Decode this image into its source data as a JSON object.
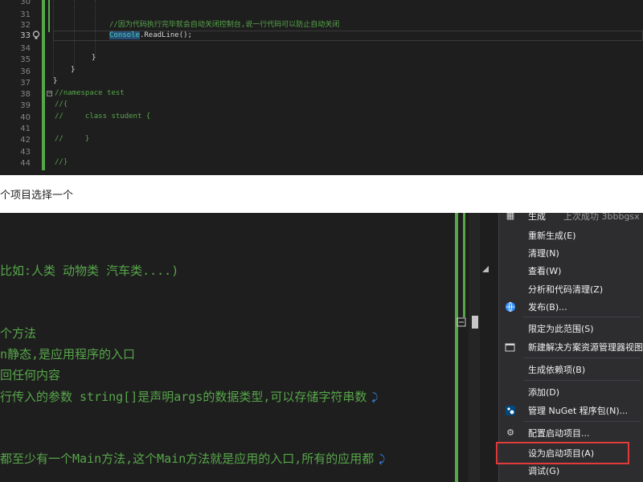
{
  "top_editor": {
    "line_numbers": [
      "30",
      "31",
      "32",
      "33",
      "34",
      "35",
      "36",
      "37",
      "38",
      "39",
      "40",
      "41",
      "42",
      "43",
      "44"
    ],
    "active_line": "33",
    "lines": {
      "l32_comment": "//因为代码执行完毕就会自动关闭控制台,说一行代码可以防止自动关闭",
      "l33_class": "Console",
      "l33_rest": ".ReadLine();",
      "l35_brace": "}",
      "l36_brace": "}",
      "l37_brace": "}",
      "l38_comment": "//namespace test",
      "l39_comment": "//{",
      "l40_comment": "//     class student {",
      "l42_comment": "//     }",
      "l44_comment": "//}"
    }
  },
  "caption": {
    "text": "个项目选择一个"
  },
  "bottom_editor": {
    "lines": [
      {
        "text": "比如:人类 动物类 汽车类....)",
        "wrap": false
      },
      {
        "text": "个方法",
        "wrap": false
      },
      {
        "text": "n静态,是应用程序的入口",
        "wrap": false
      },
      {
        "text": "回任何内容",
        "wrap": false
      },
      {
        "text": "行传入的参数 string[]是声明args的数据类型,可以存储字符串数",
        "wrap": true
      },
      {
        "text": "都至少有一个Main方法,这个Main方法就是应用的入口,所有的应用都",
        "wrap": true
      }
    ],
    "wrap_glyph": "⤸"
  },
  "context_menu": {
    "build_partial_label": "生成",
    "build_partial_extra": "上次成功  3bbbgsx",
    "items": [
      {
        "label": "重新生成(E)",
        "icon": ""
      },
      {
        "label": "清理(N)",
        "icon": ""
      },
      {
        "label": "查看(W)",
        "icon": ""
      },
      {
        "label": "分析和代码清理(Z)",
        "icon": ""
      },
      {
        "label": "发布(B)...",
        "icon": "globe-icon"
      },
      {
        "label": "限定为此范围(S)",
        "icon": ""
      },
      {
        "label": "新建解决方案资源管理器视图",
        "icon": "new-view-icon"
      },
      {
        "label": "生成依赖项(B)",
        "icon": ""
      },
      {
        "label": "添加(D)",
        "icon": ""
      },
      {
        "label": "管理 NuGet 程序包(N)...",
        "icon": "nuget-icon"
      },
      {
        "label": "配置启动项目...",
        "icon": "gear-icon"
      },
      {
        "label": "设为启动项目(A)",
        "icon": ""
      },
      {
        "label": "调试(G)",
        "icon": ""
      }
    ],
    "highlighted_item": "设为启动项目(A)"
  },
  "colors": {
    "editor_bg": "#1e1e1e",
    "comment_green": "#57a64a",
    "type_teal": "#4ec9b0",
    "menu_bg": "#2d2d30",
    "highlight_red": "#e03a3a"
  }
}
